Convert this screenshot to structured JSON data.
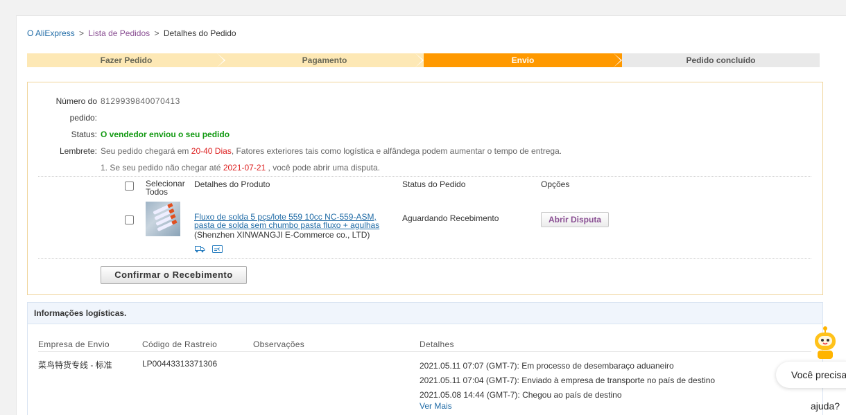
{
  "breadcrumb": {
    "home": "O AliExpress",
    "sep1": ">",
    "list": "Lista de Pedidos",
    "sep2": ">",
    "current": "Detalhes do Pedido"
  },
  "steps": [
    "Fazer Pedido",
    "Pagamento",
    "Envio",
    "Pedido concluído"
  ],
  "order": {
    "number_label_1": "Número do",
    "number_label_2": "pedido:",
    "number": "8129939840070413",
    "status_label": "Status:",
    "status": "O vendedor enviou o seu pedido",
    "reminder_label": "Lembrete:",
    "reminder_pre": "Seu pedido chegará em",
    "reminder_days": "20-40 Dias",
    "reminder_post": ", Fatores exteriores tais como logística e alfândega podem aumentar o tempo de entrega.",
    "dispute_pre": "1. Se seu pedido não chegar até",
    "dispute_date": "2021-07-21",
    "dispute_post": ", você pode abrir uma disputa."
  },
  "table": {
    "select_all_1": "Selecionar",
    "select_all_2": "Todos",
    "col_product": "Detalhes do Produto",
    "col_status": "Status do Pedido",
    "col_options": "Opções"
  },
  "product": {
    "title_1": "Fluxo de solda 5 pçs/lote 559 10cc NC-559-ASM,",
    "title_2": "pasta de solda sem chumbo pasta fluxo + agulhas",
    "seller": "(Shenzhen XINWANGJI E-Commerce co., LTD)",
    "status": "Aguardando Recebimento",
    "dispute_button": "Abrir Disputa",
    "icons": [
      "truck-icon",
      "card-icon"
    ]
  },
  "confirm_button": "Confirmar o Recebimento",
  "logistics": {
    "title": "Informações logísticas.",
    "columns": [
      "Empresa de Envio",
      "Código de Rastreio",
      "Observações",
      "Detalhes"
    ],
    "carrier": "菜鸟特货专线 - 标准",
    "tracking": "LP00443313371306",
    "details": [
      "2021.05.11 07:07 (GMT-7): Em processo de desembaraço aduaneiro",
      "2021.05.11 07:04 (GMT-7): Enviado à empresa de transporte no país de destino",
      "2021.05.08 14:44 (GMT-7): Chegou ao país de destino"
    ],
    "more": "Ver Mais"
  },
  "help": {
    "line1": "Você precisa",
    "line2": "ajuda?"
  },
  "colors": {
    "step_active": "#ff9900",
    "step_done": "#fde8b5",
    "status_green": "#119911",
    "highlight_red": "#dd2222",
    "link_blue": "#1f6ba6"
  }
}
